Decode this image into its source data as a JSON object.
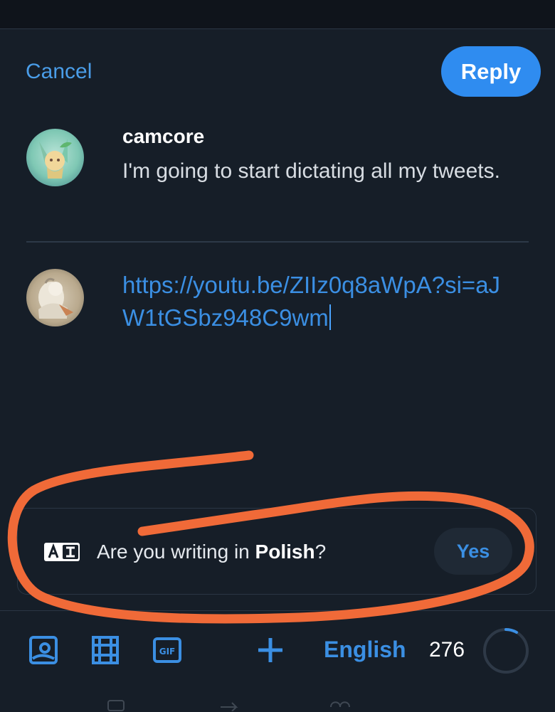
{
  "header": {
    "cancel_label": "Cancel",
    "reply_label": "Reply"
  },
  "original_post": {
    "username": "camcore",
    "text": "I'm going to start dictating all my tweets."
  },
  "compose": {
    "text": "https://youtu.be/ZIIz0q8aWpA?si=aJW1tGSbz948C9wm"
  },
  "language_prompt": {
    "question_prefix": "Are you writing in ",
    "language": "Polish",
    "question_suffix": "?",
    "yes_label": "Yes"
  },
  "toolbar": {
    "icons": [
      "image-icon",
      "video-icon",
      "gif-icon",
      "add-icon"
    ],
    "language": "English",
    "char_count": "276",
    "progress_fraction": 0.083
  },
  "colors": {
    "accent": "#2f8cf0",
    "link": "#3b8fe3",
    "background": "#161e28",
    "annotation": "#f06a38"
  }
}
